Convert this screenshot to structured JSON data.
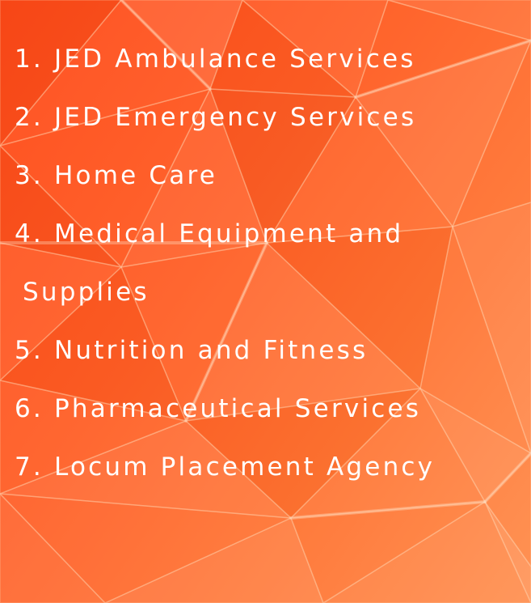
{
  "colors": {
    "background_dark": "#ff4a18",
    "background_light": "#ff8c4a",
    "text": "#ffffff"
  },
  "services": [
    {
      "label": "1. JED Ambulance Services"
    },
    {
      "label": "2. JED Emergency Services"
    },
    {
      "label": "3. Home Care"
    },
    {
      "label": "4. Medical Equipment and",
      "label_cont": "Supplies"
    },
    {
      "label": "5. Nutrition and Fitness"
    },
    {
      "label": "6. Pharmaceutical Services"
    },
    {
      "label": "7. Locum Placement Agency"
    }
  ]
}
